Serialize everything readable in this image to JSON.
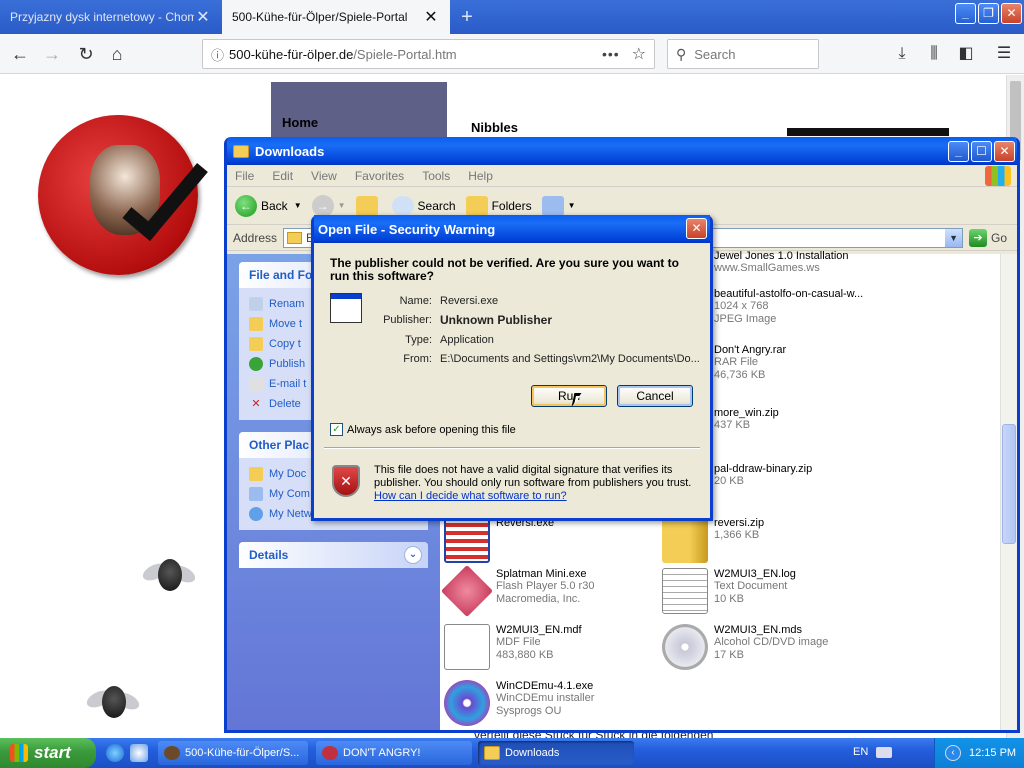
{
  "browser": {
    "tabs": [
      {
        "label": "Przyjazny dysk internetowy - Chomikuj"
      },
      {
        "label": "500-Kühe-für-Ölper/Spiele-Portal"
      }
    ],
    "url_domain": "500-kühe-für-ölper.de",
    "url_path": "/Spiele-Portal.htm",
    "search_placeholder": "Search"
  },
  "page": {
    "nav_home": "Home",
    "heading": "Nibbles",
    "footer_text": "verteilt diese Stück für Stück in die folgenden"
  },
  "explorer": {
    "title": "Downloads",
    "menu": [
      "File",
      "Edit",
      "View",
      "Favorites",
      "Tools",
      "Help"
    ],
    "toolbar": {
      "back": "Back",
      "search": "Search",
      "folders": "Folders"
    },
    "address_label": "Address",
    "address_value": "E:",
    "go_label": "Go",
    "tasks": {
      "file_and_folder_title": "File and Fo",
      "file_and_folder_items": [
        "Renam",
        "Move t",
        "Copy t",
        "Publish",
        "E-mail t",
        "Delete"
      ],
      "other_places_title": "Other Plac",
      "other_places_items": [
        "My Doc",
        "My Com",
        "My Network Places"
      ],
      "details_title": "Details"
    },
    "files": [
      {
        "name": "Jewel Jones 1.0 Installation",
        "meta1": "www.SmallGames.ws",
        "meta2": ""
      },
      {
        "name": "beautiful-astolfo-on-casual-w...",
        "meta1": "1024 x 768",
        "meta2": "JPEG Image"
      },
      {
        "name": "Don't Angry.rar",
        "meta1": "RAR File",
        "meta2": "46,736 KB"
      },
      {
        "name": "more_win.zip",
        "meta1": "437 KB",
        "meta2": ""
      },
      {
        "name": "pal-ddraw-binary.zip",
        "meta1": "20 KB",
        "meta2": ""
      },
      {
        "name": "Reversi.exe",
        "meta1": "",
        "meta2": ""
      },
      {
        "name": "reversi.zip",
        "meta1": "1,366 KB",
        "meta2": ""
      },
      {
        "name": "Splatman Mini.exe",
        "meta1": "Flash Player 5.0 r30",
        "meta2": "Macromedia, Inc."
      },
      {
        "name": "W2MUI3_EN.log",
        "meta1": "Text Document",
        "meta2": "10 KB"
      },
      {
        "name": "W2MUI3_EN.mdf",
        "meta1": "MDF File",
        "meta2": "483,880 KB"
      },
      {
        "name": "W2MUI3_EN.mds",
        "meta1": "Alcohol CD/DVD image",
        "meta2": "17 KB"
      },
      {
        "name": "WinCDEmu-4.1.exe",
        "meta1": "WinCDEmu installer",
        "meta2": "Sysprogs OU"
      }
    ]
  },
  "dialog": {
    "title": "Open File - Security Warning",
    "question": "The publisher could not be verified.  Are you sure you want to run this software?",
    "rows": [
      {
        "label": "Name:",
        "value": "Reversi.exe"
      },
      {
        "label": "Publisher:",
        "value": "Unknown Publisher"
      },
      {
        "label": "Type:",
        "value": "Application"
      },
      {
        "label": "From:",
        "value": "E:\\Documents and Settings\\vm2\\My Documents\\Do..."
      }
    ],
    "run_label": "Run",
    "cancel_label": "Cancel",
    "checkbox_label": "Always ask before opening this file",
    "checkbox_checked": true,
    "note": "This file does not have a valid digital signature that verifies its publisher.  You should only run software from publishers you trust.",
    "link": "How can I decide what software to run?"
  },
  "taskbar": {
    "start_label": "start",
    "buttons": [
      {
        "label": "500-Kühe-für-Ölper/S..."
      },
      {
        "label": "DON'T ANGRY!"
      },
      {
        "label": "Downloads"
      }
    ],
    "language": "EN",
    "clock": "12:15 PM"
  }
}
